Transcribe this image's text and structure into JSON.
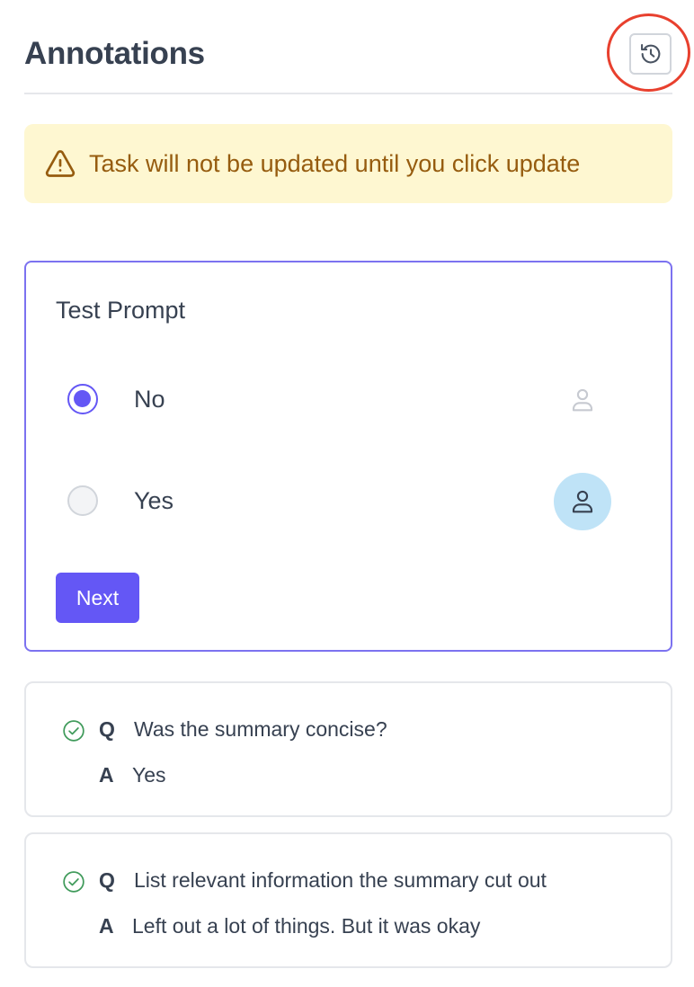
{
  "header": {
    "title": "Annotations",
    "history_icon": "history-icon"
  },
  "warning": {
    "icon": "warning-icon",
    "text": "Task will not be updated until you click update"
  },
  "prompt": {
    "title": "Test Prompt",
    "options": [
      {
        "label": "No",
        "selected": true,
        "user_icon": "user-icon",
        "user_active": false
      },
      {
        "label": "Yes",
        "selected": false,
        "user_icon": "user-icon",
        "user_active": true
      }
    ],
    "next_label": "Next"
  },
  "answers": [
    {
      "q_letter": "Q",
      "question": "Was the summary concise?",
      "a_letter": "A",
      "answer": "Yes",
      "status_icon": "check-circle-icon"
    },
    {
      "q_letter": "Q",
      "question": "List relevant information the summary cut out",
      "a_letter": "A",
      "answer": "Left out a lot of things. But it was okay",
      "status_icon": "check-circle-icon"
    }
  ],
  "colors": {
    "accent": "#6457f5",
    "warning_bg": "#fef7d1",
    "warning_text": "#965c0f",
    "highlight": "#e8402e",
    "success": "#3f9a5a",
    "user_active_bg": "#bfe3f7"
  }
}
